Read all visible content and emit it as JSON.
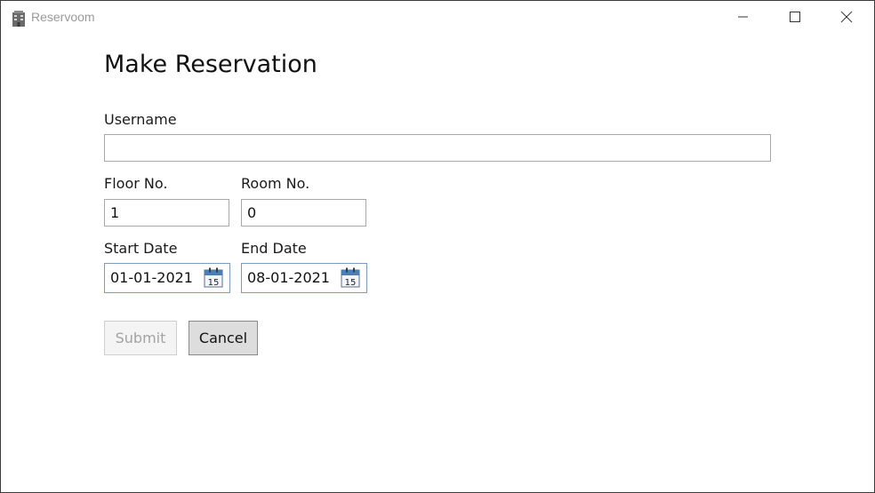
{
  "window": {
    "title": "Reservoom",
    "icon": "building-icon"
  },
  "caption": {
    "minimize": "minimize-icon",
    "maximize": "maximize-icon",
    "close": "close-icon"
  },
  "page": {
    "title": "Make Reservation"
  },
  "form": {
    "username": {
      "label": "Username",
      "value": ""
    },
    "floor": {
      "label": "Floor No.",
      "value": "1"
    },
    "room": {
      "label": "Room No.",
      "value": "0"
    },
    "start_date": {
      "label": "Start Date",
      "value": "01-01-2021",
      "calendar_day": "15"
    },
    "end_date": {
      "label": "End Date",
      "value": "08-01-2021",
      "calendar_day": "15"
    }
  },
  "buttons": {
    "submit": "Submit",
    "cancel": "Cancel"
  },
  "colors": {
    "date_border": "#7a9cc2",
    "calendar_header": "#4a7fb5"
  }
}
